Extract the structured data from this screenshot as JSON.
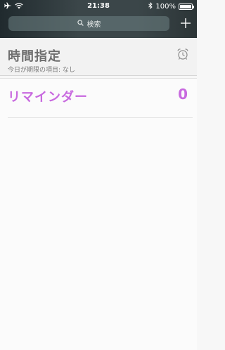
{
  "status_bar": {
    "time": "21:38",
    "battery_text": "100%",
    "battery_level": 1.0
  },
  "search": {
    "placeholder": "検索"
  },
  "scheduled": {
    "title": "時間指定",
    "subtitle": "今日が期限の項目: なし"
  },
  "reminders_list": {
    "title": "リマインダー",
    "count": "0",
    "accent_color": "#c86adf"
  },
  "icons": {
    "airplane": "airplane-icon",
    "wifi": "wifi-icon",
    "bluetooth": "bluetooth-icon",
    "battery": "battery-icon",
    "search": "search-icon",
    "add": "plus-icon",
    "alarm": "alarm-clock-icon"
  }
}
